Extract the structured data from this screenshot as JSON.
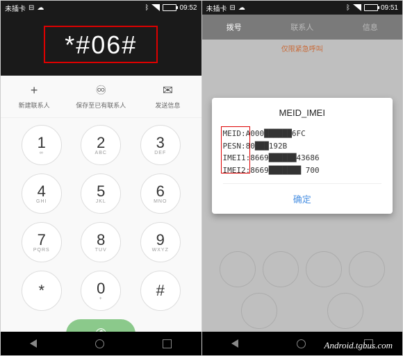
{
  "left": {
    "status": {
      "carrier": "未插卡",
      "time": "09:52"
    },
    "dialed": "*#06#",
    "actions": [
      {
        "icon": "+",
        "label": "新建联系人"
      },
      {
        "icon": "♾",
        "label": "保存至已有联系人"
      },
      {
        "icon": "✉",
        "label": "发送信息"
      }
    ],
    "keypad": [
      [
        {
          "n": "1",
          "s": "∞"
        },
        {
          "n": "2",
          "s": "ABC"
        },
        {
          "n": "3",
          "s": "DEF"
        }
      ],
      [
        {
          "n": "4",
          "s": "GHI"
        },
        {
          "n": "5",
          "s": "JKL"
        },
        {
          "n": "6",
          "s": "MNO"
        }
      ],
      [
        {
          "n": "7",
          "s": "PQRS"
        },
        {
          "n": "8",
          "s": "TUV"
        },
        {
          "n": "9",
          "s": "WXYZ"
        }
      ],
      [
        {
          "n": "*",
          "s": ""
        },
        {
          "n": "0",
          "s": "+"
        },
        {
          "n": "#",
          "s": ""
        }
      ]
    ]
  },
  "right": {
    "status": {
      "carrier": "未插卡",
      "time": "09:51"
    },
    "tabs": [
      "拨号",
      "联系人",
      "信息"
    ],
    "banner": "仅限紧急呼叫",
    "popup": {
      "title": "MEID_IMEI",
      "rows": [
        {
          "k": "MEID:",
          "v": "A000██████6FC"
        },
        {
          "k": "PESN:",
          "v": "80███192B"
        },
        {
          "k": "IMEI1:",
          "v": "8669██████43686"
        },
        {
          "k": "IMEI2:",
          "v": "8669███████ 700"
        }
      ],
      "button": "确定"
    }
  },
  "watermark": "Android.tgbus.com"
}
